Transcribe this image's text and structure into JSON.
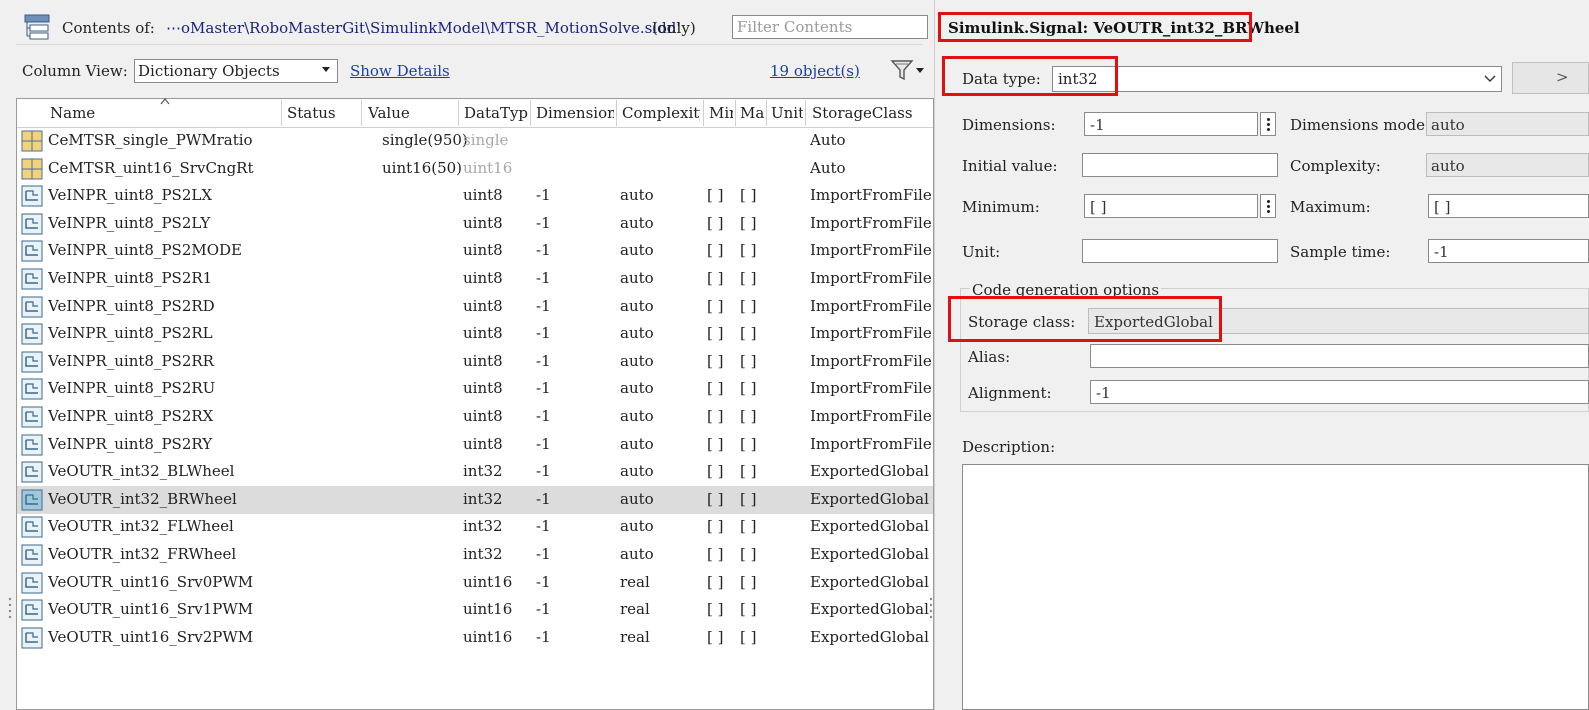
{
  "toolbar": {
    "contents_label": "Contents of:",
    "contents_path": "⋯oMaster\\RoboMasterGit\\SimulinkModel\\MTSR_MotionSolve.sldd'",
    "only_label": "(only)",
    "filter_placeholder": "Filter Contents",
    "column_view_label": "Column View:",
    "column_view_value": "Dictionary Objects",
    "show_details": "Show Details",
    "object_count": "19 object(s)"
  },
  "table": {
    "headers": [
      "Name",
      "Status",
      "Value",
      "DataType",
      "Dimensions",
      "Complexity",
      "Min",
      "Max",
      "Unit",
      "StorageClass"
    ],
    "rows": [
      {
        "icon": "parameter-icon",
        "name": "CeMTSR_single_PWMratio",
        "status": "",
        "value": "single(950)",
        "datatype": "single",
        "dimensions": "",
        "complexity": "",
        "min": "",
        "max": "",
        "storage": "Auto",
        "dim_gray": true,
        "selected": false
      },
      {
        "icon": "parameter-icon",
        "name": "CeMTSR_uint16_SrvCngRt",
        "status": "",
        "value": "uint16(50)",
        "datatype": "uint16",
        "dimensions": "",
        "complexity": "",
        "min": "",
        "max": "",
        "storage": "Auto",
        "dim_gray": true,
        "selected": false
      },
      {
        "icon": "signal-icon",
        "name": "VeINPR_uint8_PS2LX",
        "status": "",
        "value": "",
        "datatype": "uint8",
        "dimensions": "-1",
        "complexity": "auto",
        "min": "[ ]",
        "max": "[ ]",
        "storage": "ImportFromFile",
        "selected": false
      },
      {
        "icon": "signal-icon",
        "name": "VeINPR_uint8_PS2LY",
        "status": "",
        "value": "",
        "datatype": "uint8",
        "dimensions": "-1",
        "complexity": "auto",
        "min": "[ ]",
        "max": "[ ]",
        "storage": "ImportFromFile",
        "selected": false
      },
      {
        "icon": "signal-icon",
        "name": "VeINPR_uint8_PS2MODE",
        "status": "",
        "value": "",
        "datatype": "uint8",
        "dimensions": "-1",
        "complexity": "auto",
        "min": "[ ]",
        "max": "[ ]",
        "storage": "ImportFromFile",
        "selected": false
      },
      {
        "icon": "signal-icon",
        "name": "VeINPR_uint8_PS2R1",
        "status": "",
        "value": "",
        "datatype": "uint8",
        "dimensions": "-1",
        "complexity": "auto",
        "min": "[ ]",
        "max": "[ ]",
        "storage": "ImportFromFile",
        "selected": false
      },
      {
        "icon": "signal-icon",
        "name": "VeINPR_uint8_PS2RD",
        "status": "",
        "value": "",
        "datatype": "uint8",
        "dimensions": "-1",
        "complexity": "auto",
        "min": "[ ]",
        "max": "[ ]",
        "storage": "ImportFromFile",
        "selected": false
      },
      {
        "icon": "signal-icon",
        "name": "VeINPR_uint8_PS2RL",
        "status": "",
        "value": "",
        "datatype": "uint8",
        "dimensions": "-1",
        "complexity": "auto",
        "min": "[ ]",
        "max": "[ ]",
        "storage": "ImportFromFile",
        "selected": false
      },
      {
        "icon": "signal-icon",
        "name": "VeINPR_uint8_PS2RR",
        "status": "",
        "value": "",
        "datatype": "uint8",
        "dimensions": "-1",
        "complexity": "auto",
        "min": "[ ]",
        "max": "[ ]",
        "storage": "ImportFromFile",
        "selected": false
      },
      {
        "icon": "signal-icon",
        "name": "VeINPR_uint8_PS2RU",
        "status": "",
        "value": "",
        "datatype": "uint8",
        "dimensions": "-1",
        "complexity": "auto",
        "min": "[ ]",
        "max": "[ ]",
        "storage": "ImportFromFile",
        "selected": false
      },
      {
        "icon": "signal-icon",
        "name": "VeINPR_uint8_PS2RX",
        "status": "",
        "value": "",
        "datatype": "uint8",
        "dimensions": "-1",
        "complexity": "auto",
        "min": "[ ]",
        "max": "[ ]",
        "storage": "ImportFromFile",
        "selected": false
      },
      {
        "icon": "signal-icon",
        "name": "VeINPR_uint8_PS2RY",
        "status": "",
        "value": "",
        "datatype": "uint8",
        "dimensions": "-1",
        "complexity": "auto",
        "min": "[ ]",
        "max": "[ ]",
        "storage": "ImportFromFile",
        "selected": false
      },
      {
        "icon": "signal-icon",
        "name": "VeOUTR_int32_BLWheel",
        "status": "",
        "value": "",
        "datatype": "int32",
        "dimensions": "-1",
        "complexity": "auto",
        "min": "[ ]",
        "max": "[ ]",
        "storage": "ExportedGlobal",
        "selected": false
      },
      {
        "icon": "signal-icon",
        "name": "VeOUTR_int32_BRWheel",
        "status": "",
        "value": "",
        "datatype": "int32",
        "dimensions": "-1",
        "complexity": "auto",
        "min": "[ ]",
        "max": "[ ]",
        "storage": "ExportedGlobal",
        "selected": true
      },
      {
        "icon": "signal-icon",
        "name": "VeOUTR_int32_FLWheel",
        "status": "",
        "value": "",
        "datatype": "int32",
        "dimensions": "-1",
        "complexity": "auto",
        "min": "[ ]",
        "max": "[ ]",
        "storage": "ExportedGlobal",
        "selected": false
      },
      {
        "icon": "signal-icon",
        "name": "VeOUTR_int32_FRWheel",
        "status": "",
        "value": "",
        "datatype": "int32",
        "dimensions": "-1",
        "complexity": "auto",
        "min": "[ ]",
        "max": "[ ]",
        "storage": "ExportedGlobal",
        "selected": false
      },
      {
        "icon": "signal-icon",
        "name": "VeOUTR_uint16_Srv0PWM",
        "status": "",
        "value": "",
        "datatype": "uint16",
        "dimensions": "-1",
        "complexity": "real",
        "min": "[ ]",
        "max": "[ ]",
        "storage": "ExportedGlobal",
        "selected": false
      },
      {
        "icon": "signal-icon",
        "name": "VeOUTR_uint16_Srv1PWM",
        "status": "",
        "value": "",
        "datatype": "uint16",
        "dimensions": "-1",
        "complexity": "real",
        "min": "[ ]",
        "max": "[ ]",
        "storage": "ExportedGlobal",
        "selected": false
      },
      {
        "icon": "signal-icon",
        "name": "VeOUTR_uint16_Srv2PWM",
        "status": "",
        "value": "",
        "datatype": "uint16",
        "dimensions": "-1",
        "complexity": "real",
        "min": "[ ]",
        "max": "[ ]",
        "storage": "ExportedGlobal",
        "selected": false
      }
    ]
  },
  "details": {
    "title": "Simulink.Signal: VeOUTR_int32_BRWheel",
    "data_type_label": "Data type:",
    "data_type_value": "int32",
    "dimensions_label": "Dimensions:",
    "dimensions_value": "-1",
    "dimensions_mode_label": "Dimensions mode:",
    "dimensions_mode_value": "auto",
    "initial_value_label": "Initial value:",
    "initial_value_value": "",
    "complexity_label": "Complexity:",
    "complexity_value": "auto",
    "minimum_label": "Minimum:",
    "minimum_value": "[ ]",
    "maximum_label": "Maximum:",
    "maximum_value": "[ ]",
    "unit_label": "Unit:",
    "unit_value": "",
    "sample_time_label": "Sample time:",
    "sample_time_value": "-1",
    "codegen_legend": "Code generation options",
    "storage_class_label": "Storage class:",
    "storage_class_value": "ExportedGlobal",
    "alias_label": "Alias:",
    "alias_value": "",
    "alignment_label": "Alignment:",
    "alignment_value": "-1",
    "description_label": "Description:",
    "description_value": ""
  },
  "colors": {
    "highlight_red": "#e01010",
    "link_blue": "#1a3fa6",
    "selected_row": "#dcdcdc"
  }
}
